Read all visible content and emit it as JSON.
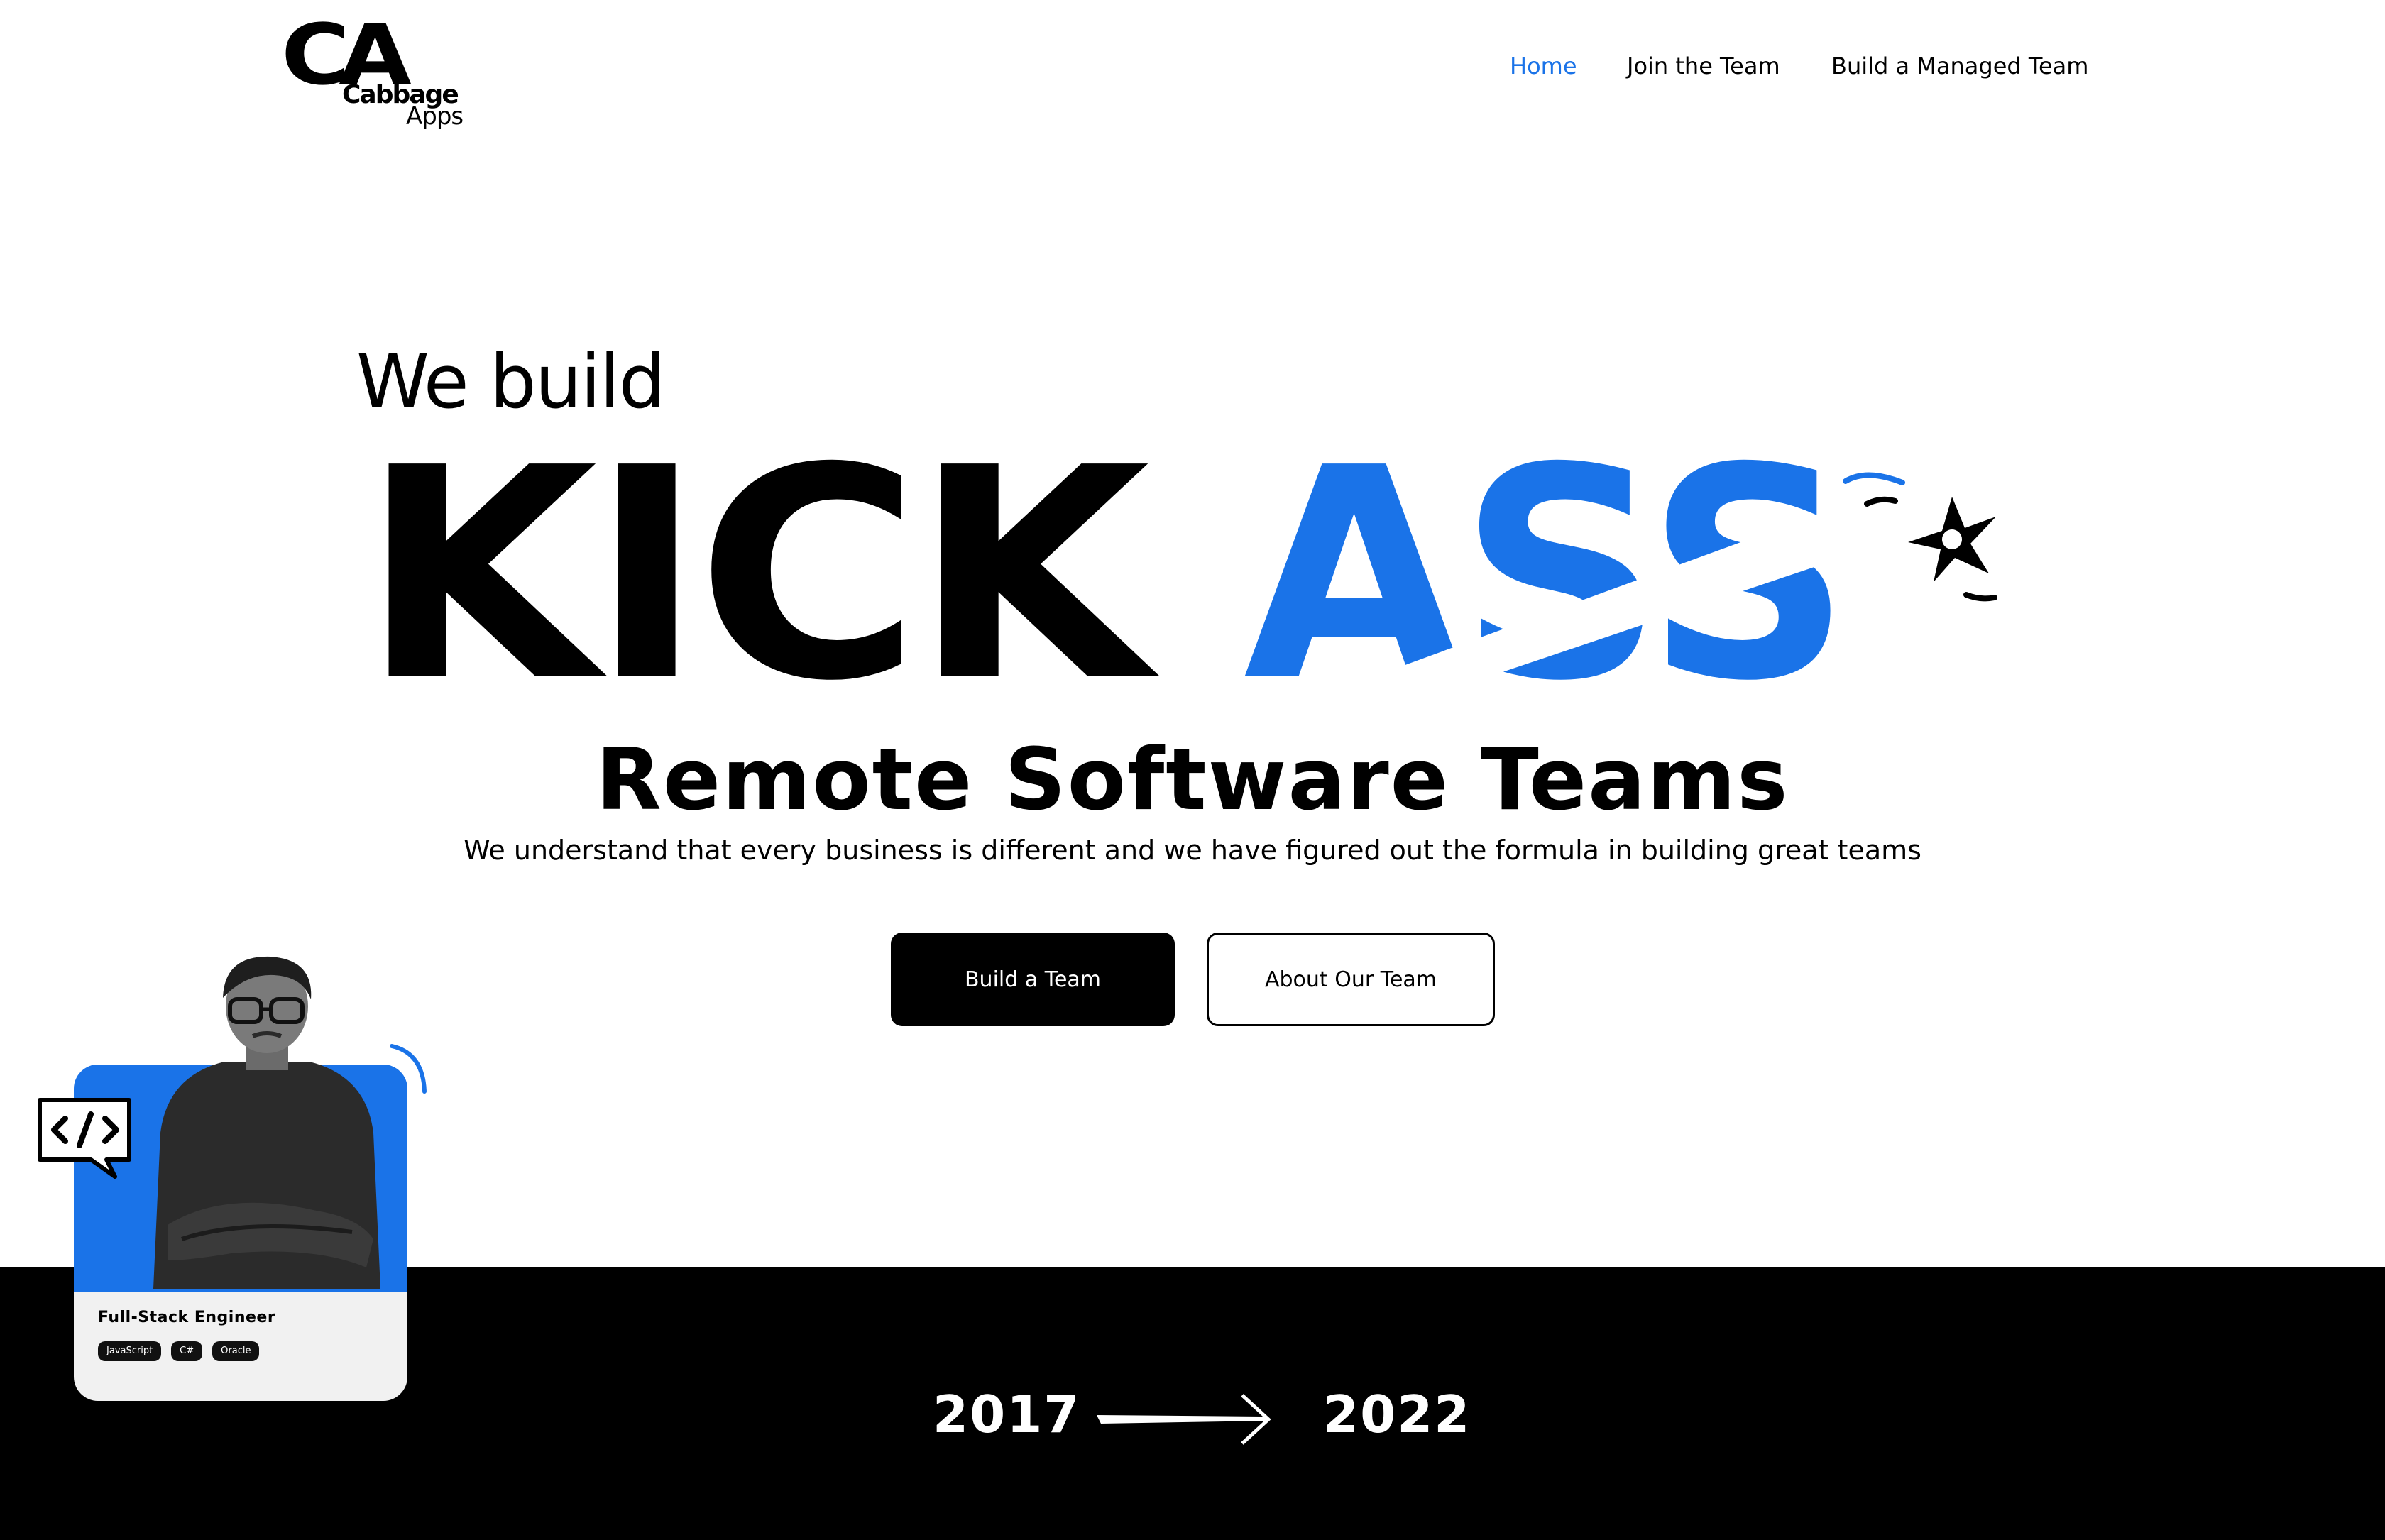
{
  "brand": {
    "logo_mark": "CA",
    "name_line1": "Cabbage",
    "name_line2": "Apps"
  },
  "nav": {
    "items": [
      {
        "label": "Home",
        "active": true
      },
      {
        "label": "Join the Team",
        "active": false
      },
      {
        "label": "Build a Managed Team",
        "active": false
      }
    ]
  },
  "hero": {
    "eyebrow": "We build",
    "word_black": "KICK",
    "word_blue": "ASS",
    "headline": "Remote Software Teams",
    "subtitle": "We understand that every business is different and we have figured out the formula in building great teams",
    "primary_button": "Build a Team",
    "secondary_button": "About Our Team"
  },
  "profile_card": {
    "role": "Full-Stack Engineer",
    "tags": [
      "JavaScript",
      "C#",
      "Oracle"
    ],
    "code_icon": "code-tag-icon"
  },
  "timeline": {
    "start_year": "2017",
    "end_year": "2022",
    "icon": "long-arrow-right-icon"
  },
  "icons": {
    "shuriken": "shuriken-icon"
  },
  "colors": {
    "accent": "#1a73e8",
    "text": "#000000",
    "background": "#ffffff",
    "band": "#000000",
    "card_bg": "#f1f1f1"
  }
}
